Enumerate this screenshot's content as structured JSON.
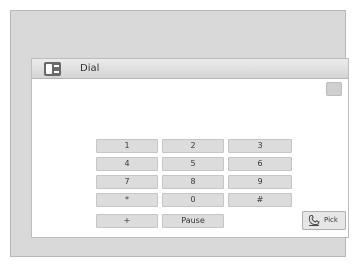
{
  "titlebar": {
    "title": "Dial"
  },
  "icons": {
    "phone": "phone-icon",
    "pick": "pick-up-phone-icon"
  },
  "clear_button": {
    "label": ""
  },
  "keypad": {
    "keys": [
      "1",
      "2",
      "3",
      "4",
      "5",
      "6",
      "7",
      "8",
      "9",
      "*",
      "0",
      "#",
      "+",
      "Pause"
    ]
  },
  "pick_button": {
    "label": "Pick"
  },
  "colors": {
    "frame": "#d9d9d9",
    "titlebar": "#d4d4d4",
    "key": "#dcdcdc"
  }
}
